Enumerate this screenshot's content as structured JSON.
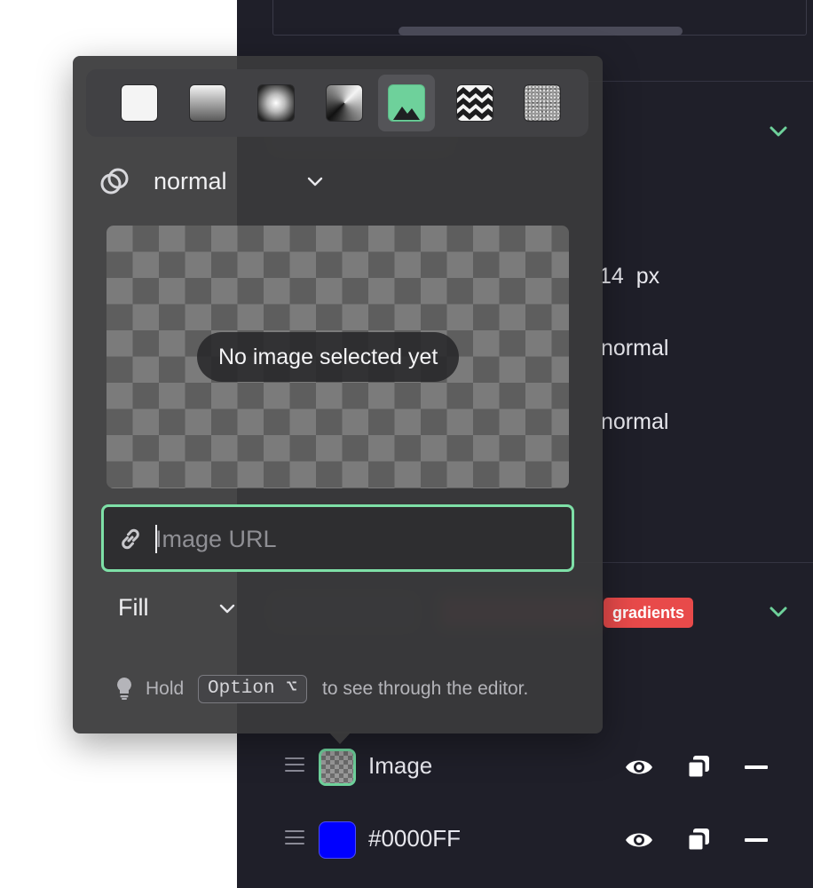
{
  "inspector": {
    "size_value": "14",
    "size_unit": "px",
    "weight_value": "normal",
    "style_value": "normal",
    "badge": "gradients"
  },
  "popover": {
    "fill_types": [
      {
        "name": "solid",
        "icon": "solid-fill-icon"
      },
      {
        "name": "linear",
        "icon": "linear-gradient-icon"
      },
      {
        "name": "radial",
        "icon": "radial-gradient-icon"
      },
      {
        "name": "conic",
        "icon": "conic-gradient-icon"
      },
      {
        "name": "image",
        "icon": "image-fill-icon",
        "selected": true
      },
      {
        "name": "pattern",
        "icon": "pattern-fill-icon"
      },
      {
        "name": "noise",
        "icon": "noise-fill-icon"
      }
    ],
    "blend_mode": "normal",
    "preview_message": "No image selected yet",
    "url_placeholder": "Image URL",
    "url_value": "",
    "fit_mode": "Fill",
    "hint": {
      "before": "Hold",
      "key": "Option ⌥",
      "after": "to see through the editor."
    }
  },
  "layers": [
    {
      "label": "Image",
      "type": "image"
    },
    {
      "label": "#0000FF",
      "color": "#0000FF"
    }
  ],
  "colors": {
    "accent": "#7EE0A7",
    "badge": "#E84A4A",
    "panel_bg": "#1F1F29",
    "popover_bg": "#3A3A3C"
  }
}
